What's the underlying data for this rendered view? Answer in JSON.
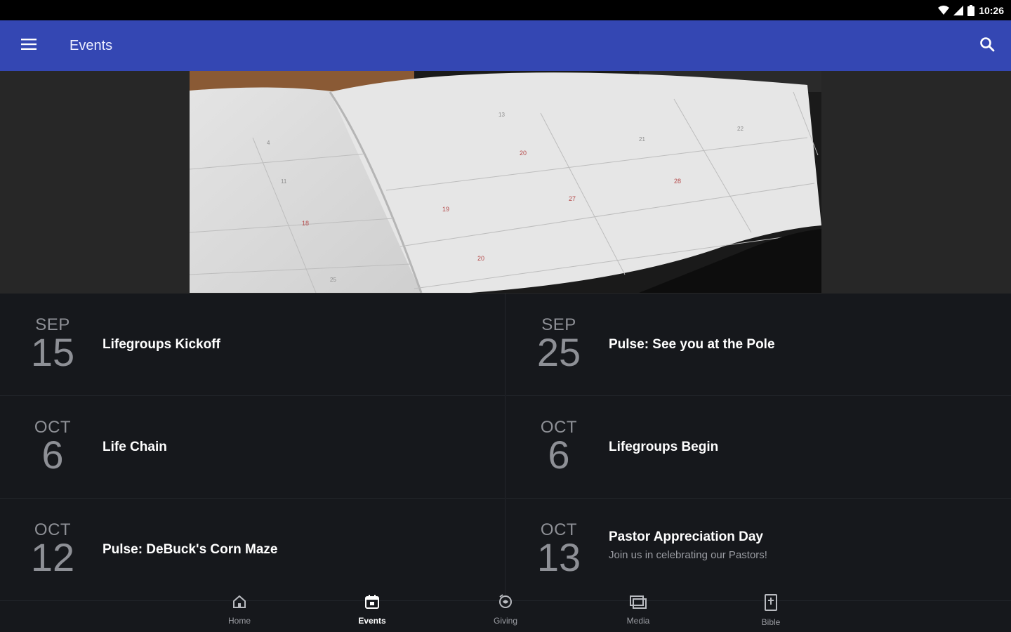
{
  "status_bar": {
    "time": "10:26",
    "icons": [
      "wifi-icon",
      "signal-icon",
      "battery-icon"
    ]
  },
  "app_bar": {
    "title": "Events",
    "menu_icon": "menu-icon",
    "search_icon": "search-icon",
    "color": "#3447b3"
  },
  "hero": {
    "image": "open-planner-calendar-photo"
  },
  "events": [
    {
      "month": "SEP",
      "day": "15",
      "title": "Lifegroups Kickoff",
      "subtitle": ""
    },
    {
      "month": "SEP",
      "day": "25",
      "title": "Pulse: See you at the Pole",
      "subtitle": ""
    },
    {
      "month": "OCT",
      "day": "6",
      "title": "Life Chain",
      "subtitle": ""
    },
    {
      "month": "OCT",
      "day": "6",
      "title": "Lifegroups Begin",
      "subtitle": ""
    },
    {
      "month": "OCT",
      "day": "12",
      "title": "Pulse: DeBuck's Corn Maze",
      "subtitle": ""
    },
    {
      "month": "OCT",
      "day": "13",
      "title": "Pastor Appreciation Day",
      "subtitle": "Join us in celebrating our Pastors!"
    }
  ],
  "bottom_nav": {
    "items": [
      {
        "label": "Home",
        "icon": "home-icon",
        "active": false
      },
      {
        "label": "Events",
        "icon": "calendar-icon",
        "active": true
      },
      {
        "label": "Giving",
        "icon": "giving-icon",
        "active": false
      },
      {
        "label": "Media",
        "icon": "media-icon",
        "active": false
      },
      {
        "label": "Bible",
        "icon": "bible-icon",
        "active": false
      }
    ]
  }
}
